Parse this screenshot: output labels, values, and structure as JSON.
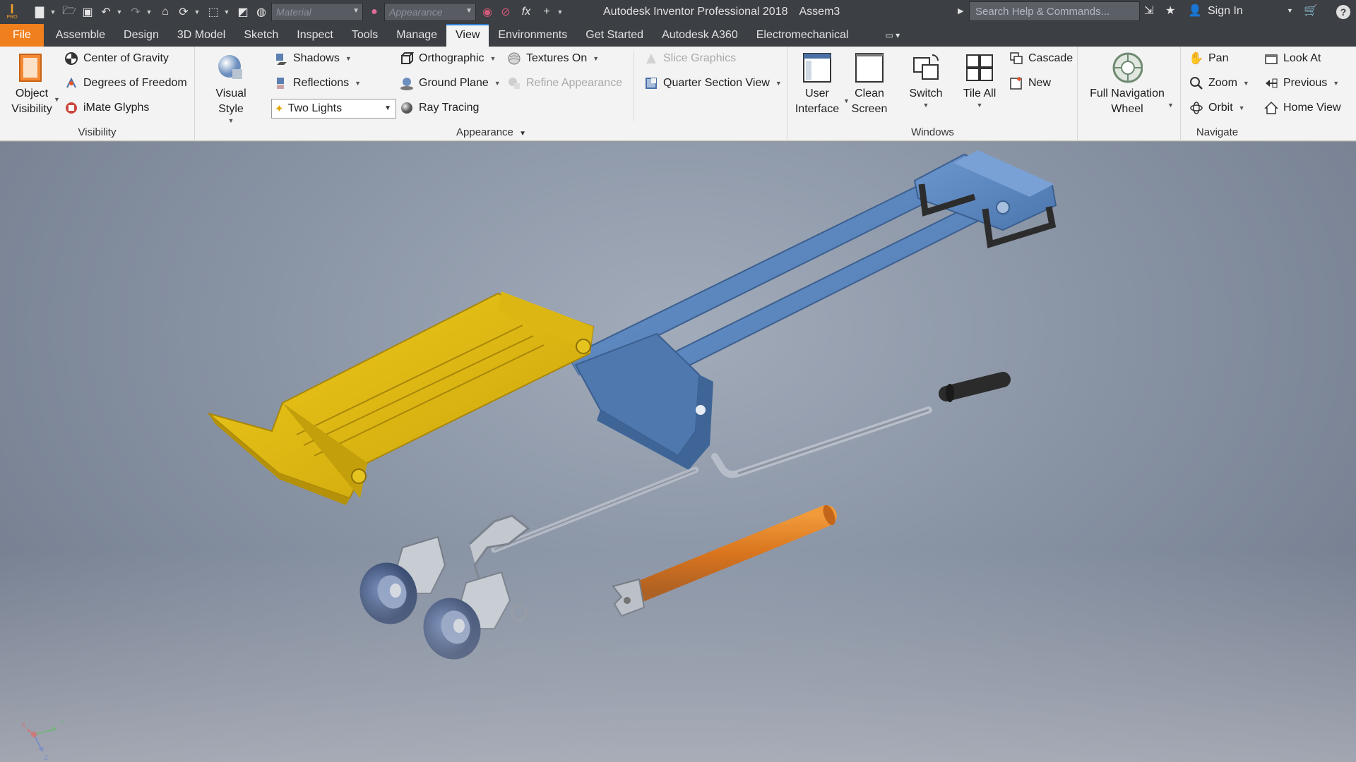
{
  "titlebar": {
    "app_badge": "PRO",
    "material_placeholder": "Material",
    "appearance_placeholder": "Appearance",
    "fx_label": "fx",
    "app_title": "Autodesk Inventor Professional 2018",
    "doc_title": "Assem3",
    "search_placeholder": "Search Help & Commands...",
    "sign_in": "Sign In"
  },
  "menu": {
    "tabs": [
      "File",
      "Assemble",
      "Design",
      "3D Model",
      "Sketch",
      "Inspect",
      "Tools",
      "Manage",
      "View",
      "Environments",
      "Get Started",
      "Autodesk A360",
      "Electromechanical"
    ],
    "active": "View"
  },
  "ribbon": {
    "visibility": {
      "title": "Visibility",
      "object_visibility": "Object\nVisibility",
      "center_of_gravity": "Center of Gravity",
      "degrees_of_freedom": "Degrees of Freedom",
      "imate_glyphs": "iMate Glyphs"
    },
    "appearance": {
      "title": "Appearance",
      "visual_style": "Visual Style",
      "shadows": "Shadows",
      "reflections": "Reflections",
      "lights": "Two Lights",
      "orthographic": "Orthographic",
      "ground_plane": "Ground Plane",
      "ray_tracing": "Ray Tracing",
      "textures_on": "Textures On",
      "refine_appearance": "Refine Appearance",
      "slice_graphics": "Slice Graphics",
      "quarter_section_view": "Quarter Section View"
    },
    "windows": {
      "title": "Windows",
      "user_interface": "User\nInterface",
      "clean_screen": "Clean\nScreen",
      "switch": "Switch",
      "tile_all": "Tile All",
      "cascade": "Cascade",
      "new": "New"
    },
    "navigate": {
      "title": "Navigate",
      "full_navigation_wheel": "Full Navigation\nWheel",
      "pan": "Pan",
      "zoom": "Zoom",
      "orbit": "Orbit",
      "look_at": "Look At",
      "previous": "Previous",
      "home_view": "Home View"
    }
  },
  "triad": {
    "x": "X",
    "y": "Y",
    "z": "Z"
  },
  "colors": {
    "file_tab": "#f07f1d",
    "frame_blue": "#5b86bd",
    "tray_yellow": "#d9b410",
    "roller_orange": "#d8731c",
    "wheel_blue": "#4c6595"
  }
}
